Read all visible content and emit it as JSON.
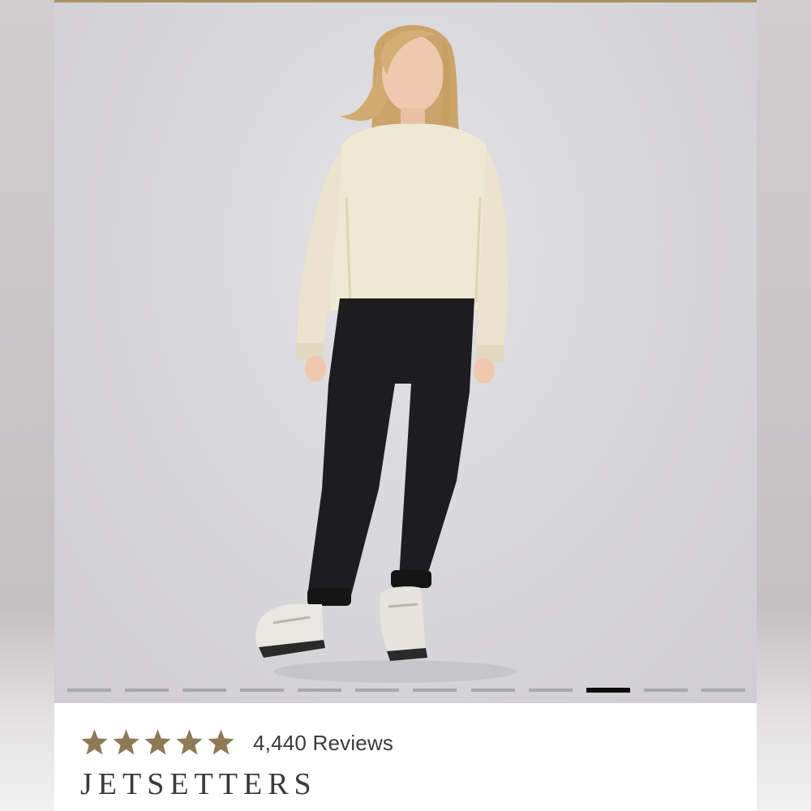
{
  "product": {
    "image_alt_subject": "model-in-cream-sweatshirt-and-black-joggers",
    "carousel": {
      "total": 12,
      "active_index": 9
    },
    "rating": {
      "stars": 5,
      "review_text": "4,440 Reviews"
    },
    "brand": "JETSETTERS"
  },
  "colors": {
    "accent_gold": "#a98f62",
    "star": "#8f7a55",
    "dot_inactive": "#a9a8ab",
    "dot_active": "#0c0c0c"
  }
}
